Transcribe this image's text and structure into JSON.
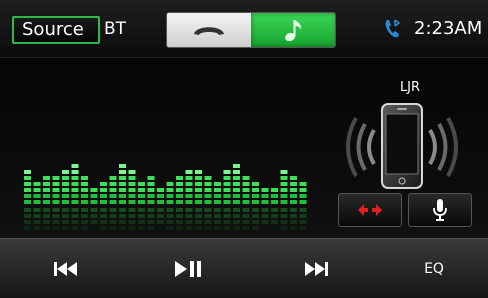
{
  "header": {
    "source_label": "Source",
    "source_value": "BT",
    "clock": "2:23AM"
  },
  "tabs": [
    {
      "name": "phone",
      "icon": "phone-handset-icon",
      "active": false
    },
    {
      "name": "music",
      "icon": "music-note-icon",
      "active": true
    }
  ],
  "device": {
    "name": "LJR"
  },
  "equalizer": {
    "levels": [
      6,
      4,
      5,
      5,
      6,
      7,
      5,
      3,
      4,
      5,
      7,
      6,
      4,
      5,
      3,
      4,
      5,
      6,
      6,
      5,
      4,
      6,
      7,
      5,
      4,
      3,
      3,
      6,
      5,
      4
    ]
  },
  "controls": {
    "prev": "skip-previous-icon",
    "play": "play-pause-icon",
    "next": "skip-next-icon",
    "eq_label": "EQ"
  },
  "colors": {
    "accent": "#2fb84a",
    "swap_icon": "#e02020",
    "bt_icon": "#2a8ad8"
  }
}
